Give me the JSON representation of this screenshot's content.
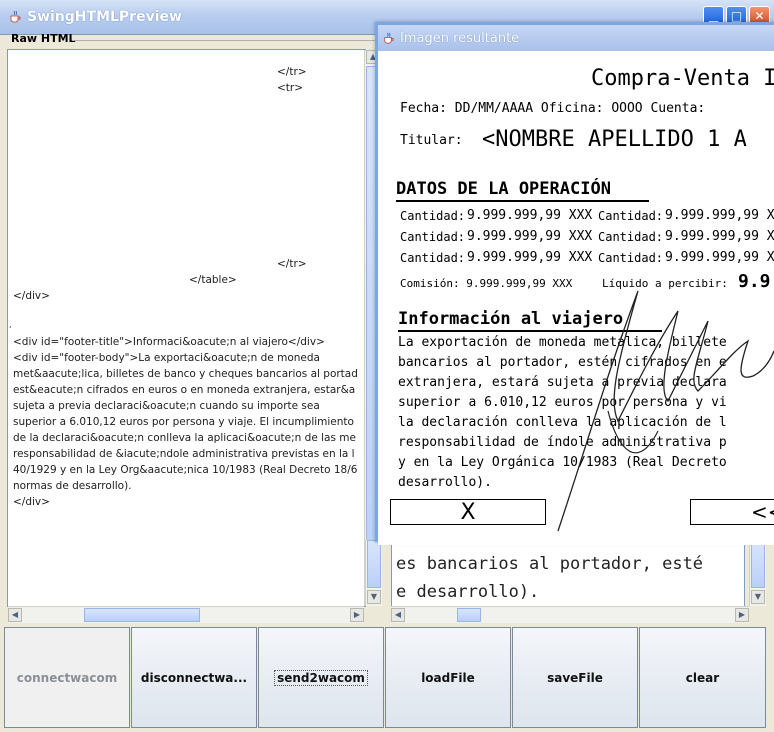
{
  "window": {
    "title": "SwingHTMLPreview"
  },
  "raw_panel": {
    "label": "Raw HTML",
    "lines": [
      "</tr>",
      "<tr>",
      "</tr>",
      "</table>",
      "</div>",
      "<div id=\"footer-title\">Informaci&oacute;n al viajero</div>",
      "<div id=\"footer-body\">La exportaci&oacute;n de moneda",
      "met&aacute;lica, billetes de banco y cheques bancarios al portad",
      "est&eacute;n cifrados en euros o en moneda extranjera, estar&a",
      "sujeta a previa declaraci&oacute;n cuando su importe sea",
      "superior a 6.010,12 euros por persona y viaje. El incumplimiento",
      "de la declaraci&oacute;n conlleva la aplicaci&oacute;n de las me",
      "responsabilidad de &iacute;ndole administrativa previstas en la l",
      "40/1929 y en la Ley Org&aacute;nica 10/1983 (Real Decreto 18/6",
      "normas de desarrollo).",
      "</div>"
    ]
  },
  "right_panel": {
    "lines": [
      "es bancarios al portador, esté",
      "e desarrollo)."
    ]
  },
  "buttons": [
    {
      "label": "connectwacom",
      "enabled": false
    },
    {
      "label": "disconnectwa...",
      "enabled": true
    },
    {
      "label": "send2wacom",
      "enabled": true,
      "focused": true
    },
    {
      "label": "loadFile",
      "enabled": true
    },
    {
      "label": "saveFile",
      "enabled": true
    },
    {
      "label": "clear",
      "enabled": true
    }
  ],
  "preview": {
    "title": "Imagen resultante",
    "doc_title": "Compra-Venta I",
    "fecha_line": "Fecha:   DD/MM/AAAA  Oficina:  OOOO  Cuenta:",
    "titular_label": "Titular:",
    "titular_value": "<NOMBRE APELLIDO 1 A",
    "section1": "DATOS DE LA OPERACIÓN",
    "qty_rows": [
      {
        "l1": "Cantidad:",
        "v1": "9.999.999,99 XXX",
        "l2": "Cantidad:",
        "v2": "9.999.999,99 X"
      },
      {
        "l1": "Cantidad:",
        "v1": "9.999.999,99 XXX",
        "l2": "Cantidad:",
        "v2": "9.999.999,99 X"
      },
      {
        "l1": "Cantidad:",
        "v1": "9.999.999,99 XXX",
        "l2": "Cantidad:",
        "v2": "9.999.999,99 X"
      }
    ],
    "comision": "Comisión: 9.999.999,99 XXX",
    "liquido_label": "Líquido a percibir:",
    "liquido_value": "9.9",
    "section2": "Información al viajero",
    "body_lines": [
      "La exportación de moneda metálica, billete",
      "bancarios al portador, estén cifrados en e",
      "extranjera, estará sujeta a previa declara",
      "superior a 6.010,12 euros por persona y vi",
      "la declaración conlleva la aplicación de l",
      "responsabilidad de índole administrativa p",
      "y en la Ley Orgánica 10/1983 (Real Decreto",
      "desarrollo)."
    ],
    "x_button": "X",
    "back_button": "<<"
  },
  "colors": {
    "title_bar": "#a9c1ea",
    "editor_border": "#7f9db9"
  }
}
